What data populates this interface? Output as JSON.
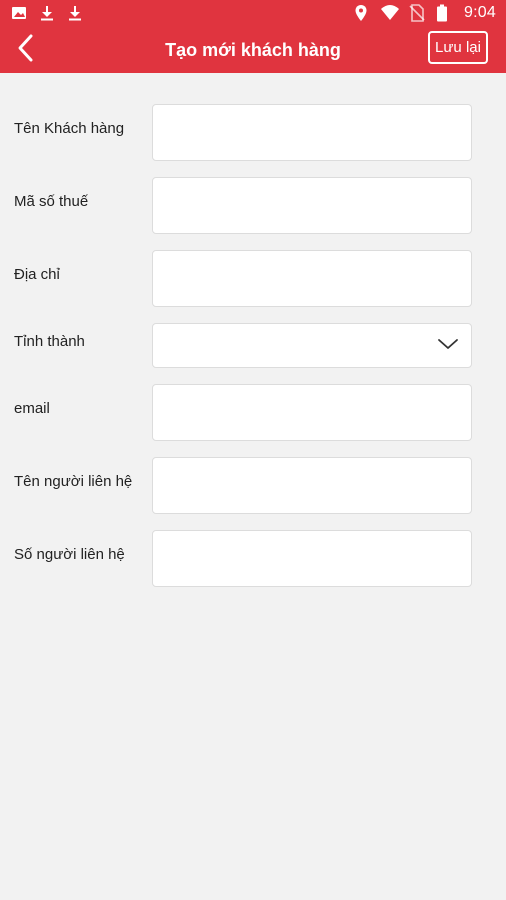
{
  "status_bar": {
    "time": "9:04",
    "left_icons": [
      "image-icon",
      "download-icon",
      "download-icon"
    ],
    "right_icons": [
      "location-icon",
      "wifi-icon",
      "no-sim-icon",
      "battery-icon"
    ]
  },
  "header": {
    "title": "Tạo mới khách hàng",
    "save_label": "Lưu lại",
    "background_color": "#e0343f"
  },
  "form": {
    "fields": [
      {
        "label": "Tên Khách hàng",
        "value": "",
        "type": "text"
      },
      {
        "label": "Mã số thuế",
        "value": "",
        "type": "text"
      },
      {
        "label": "Địa chỉ",
        "value": "",
        "type": "text"
      },
      {
        "label": "Tỉnh thành",
        "value": "",
        "type": "select"
      },
      {
        "label": "email",
        "value": "",
        "type": "text"
      },
      {
        "label": "Tên người liên hệ",
        "value": "",
        "type": "text"
      },
      {
        "label": "Số người liên hệ",
        "value": "",
        "type": "text"
      }
    ]
  }
}
